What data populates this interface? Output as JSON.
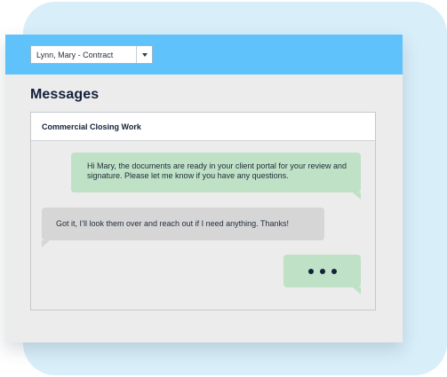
{
  "client_select": {
    "value": "Lynn, Mary - Contract"
  },
  "page": {
    "title": "Messages"
  },
  "conversation": {
    "subject": "Commercial Closing Work",
    "messages": [
      {
        "direction": "outgoing",
        "text": "Hi Mary, the documents are ready in your client portal for your review and signature. Please let me know if you have any questions."
      },
      {
        "direction": "incoming",
        "text": "Got it, I’ll look them over and reach out if I need anything. Thanks!"
      }
    ],
    "typing_indicator": "typing-dots"
  },
  "colors": {
    "header_bar": "#5fc2fb",
    "backdrop": "#d8eef9",
    "outgoing_bubble": "#bfe1c5",
    "incoming_bubble": "#d6d6d6",
    "title_text": "#13203b"
  }
}
